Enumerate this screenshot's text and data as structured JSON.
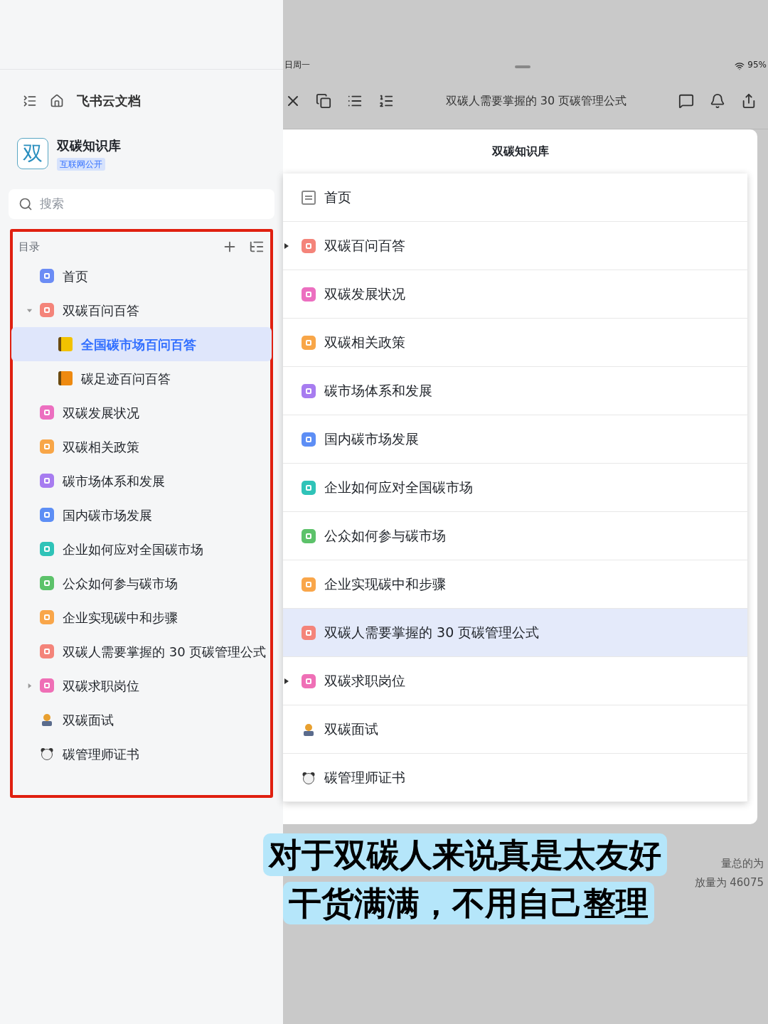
{
  "sidebar": {
    "app_title": "飞书云文档",
    "space": {
      "logo": "双",
      "name": "双碳知识库",
      "badge": "互联网公开"
    },
    "search": {
      "placeholder": "搜索"
    },
    "toc": {
      "title": "目录",
      "items": [
        {
          "label": "首页",
          "kind": "square",
          "color": "#6b8cf5",
          "selected": false
        },
        {
          "label": "双碳百问百答",
          "kind": "square",
          "color": "#f4847a",
          "selected": false,
          "expanded": true,
          "children": [
            {
              "label": "全国碳市场百问百答",
              "kind": "book",
              "color": "#f2c200",
              "selected": true
            },
            {
              "label": "碳足迹百问百答",
              "kind": "book",
              "color": "#ee8a10",
              "selected": false
            }
          ]
        },
        {
          "label": "双碳发展状况",
          "kind": "square",
          "color": "#ec6fc0",
          "selected": false
        },
        {
          "label": "双碳相关政策",
          "kind": "square",
          "color": "#f8a648",
          "selected": false
        },
        {
          "label": "碳市场体系和发展",
          "kind": "square",
          "color": "#a77cf0",
          "selected": false
        },
        {
          "label": "国内碳市场发展",
          "kind": "square",
          "color": "#5d8ef5",
          "selected": false
        },
        {
          "label": "企业如何应对全国碳市场",
          "kind": "square",
          "color": "#2fc3b8",
          "selected": false
        },
        {
          "label": "公众如何参与碳市场",
          "kind": "square",
          "color": "#5cc26a",
          "selected": false
        },
        {
          "label": "企业实现碳中和步骤",
          "kind": "square",
          "color": "#f9a64a",
          "selected": false
        },
        {
          "label": "双碳人需要掌握的 30 页碳管理公式",
          "kind": "square",
          "color": "#f4847a",
          "selected": false
        },
        {
          "label": "双碳求职岗位",
          "kind": "square",
          "color": "#ef6fb6",
          "selected": false,
          "expanded": false
        },
        {
          "label": "双碳面试",
          "kind": "figure",
          "selected": false
        },
        {
          "label": "碳管理师证书",
          "kind": "animal",
          "selected": false
        }
      ]
    }
  },
  "status_bar": {
    "date": "日周一",
    "battery": "95%"
  },
  "toolbar": {
    "title": "双碳人需要掌握的 30 页碳管理公式"
  },
  "modal": {
    "title": "双碳知识库",
    "items": [
      {
        "label": "首页",
        "kind": "page",
        "selected": false
      },
      {
        "label": "双碳百问百答",
        "kind": "square",
        "color": "#f4847a",
        "selected": false,
        "expanded": false
      },
      {
        "label": "双碳发展状况",
        "kind": "square",
        "color": "#ec6fc0",
        "selected": false
      },
      {
        "label": "双碳相关政策",
        "kind": "square",
        "color": "#f8a648",
        "selected": false
      },
      {
        "label": "碳市场体系和发展",
        "kind": "square",
        "color": "#a77cf0",
        "selected": false
      },
      {
        "label": "国内碳市场发展",
        "kind": "square",
        "color": "#5d8ef5",
        "selected": false
      },
      {
        "label": "企业如何应对全国碳市场",
        "kind": "square",
        "color": "#2fc3b8",
        "selected": false
      },
      {
        "label": "公众如何参与碳市场",
        "kind": "square",
        "color": "#5cc26a",
        "selected": false
      },
      {
        "label": "企业实现碳中和步骤",
        "kind": "square",
        "color": "#f9a64a",
        "selected": false
      },
      {
        "label": "双碳人需要掌握的 30 页碳管理公式",
        "kind": "square",
        "color": "#f4847a",
        "selected": true
      },
      {
        "label": "双碳求职岗位",
        "kind": "square",
        "color": "#ef6fb6",
        "selected": false,
        "expanded": false
      },
      {
        "label": "双碳面试",
        "kind": "figure",
        "selected": false
      },
      {
        "label": "碳管理师证书",
        "kind": "animal",
        "selected": false
      }
    ]
  },
  "document": {
    "lines": [
      "量总的为",
      "放量为 46075"
    ]
  },
  "caption": [
    "对于双碳人来说真是太友好",
    "干货满满，不用自己整理"
  ]
}
